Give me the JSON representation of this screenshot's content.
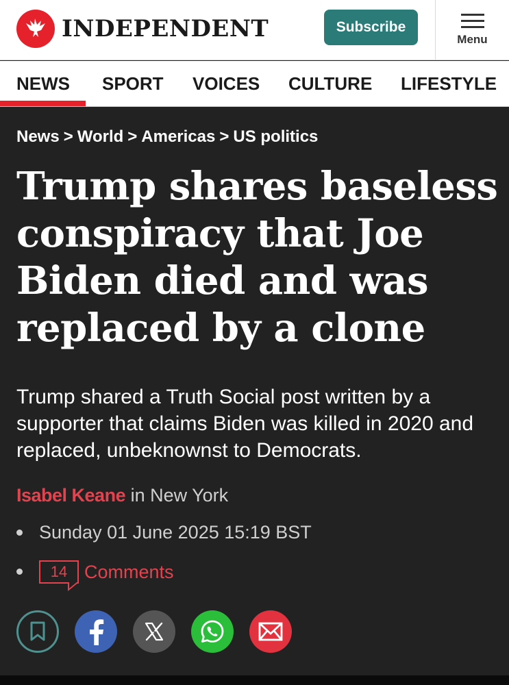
{
  "header": {
    "brand": "INDEPENDENT",
    "logo_icon": "eagle-icon",
    "subscribe_label": "Subscribe",
    "menu_label": "Menu",
    "colors": {
      "brand_red": "#e5222c",
      "subscribe_teal": "#2b7c79"
    }
  },
  "nav": {
    "items": [
      {
        "label": "NEWS",
        "active": true
      },
      {
        "label": "SPORT",
        "active": false
      },
      {
        "label": "VOICES",
        "active": false
      },
      {
        "label": "CULTURE",
        "active": false
      },
      {
        "label": "LIFESTYLE",
        "active": false
      }
    ]
  },
  "breadcrumb": {
    "items": [
      "News",
      "World",
      "Americas",
      "US politics"
    ],
    "separator": ">"
  },
  "article": {
    "headline": "Trump shares baseless conspiracy that Joe Biden died and was replaced by a clone",
    "standfirst": "Trump shared a Truth Social post written by a supporter that claims Biden was killed in 2020 and replaced, unbeknownst to Democrats.",
    "author": "Isabel Keane",
    "location_text": " in New York",
    "date": "Sunday 01 June 2025 15:19 BST",
    "comment_count": "14",
    "comments_label": "Comments",
    "background": "#222222",
    "accent": "#e2434f"
  },
  "share": {
    "buttons": [
      {
        "icon": "bookmark-icon",
        "color": "#4f918e"
      },
      {
        "icon": "facebook-icon",
        "color": "#3f63b4"
      },
      {
        "icon": "x-icon",
        "color": "#555555"
      },
      {
        "icon": "whatsapp-icon",
        "color": "#2bbe3a"
      },
      {
        "icon": "email-icon",
        "color": "#e2323f"
      }
    ]
  }
}
